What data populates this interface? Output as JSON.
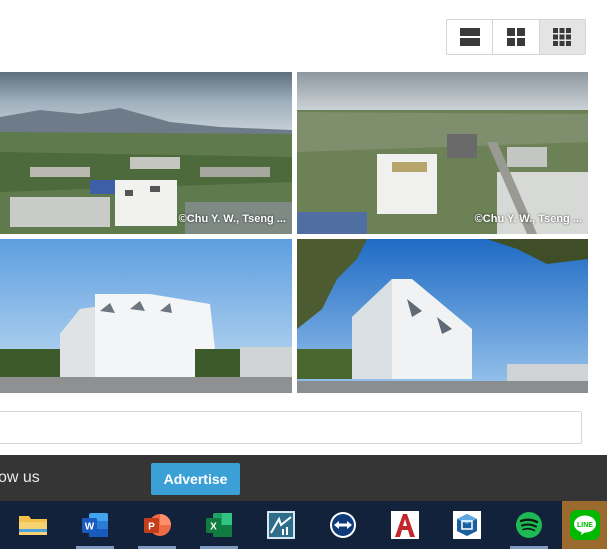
{
  "view_toggles": [
    {
      "name": "single-column-view-icon",
      "active": false
    },
    {
      "name": "two-column-grid-view-icon",
      "active": false
    },
    {
      "name": "three-column-grid-view-icon",
      "active": true
    }
  ],
  "photos": [
    {
      "credit": "©Chu Y. W., Tseng ..."
    },
    {
      "credit": "©Chu Y. W., Tseng ..."
    },
    {
      "credit": ""
    },
    {
      "credit": ""
    }
  ],
  "footer": {
    "follow_text": "ow us",
    "advertise_label": "Advertise"
  },
  "taskbar": {
    "apps": [
      {
        "name": "file-explorer-icon",
        "color": "#f4c04a",
        "running": false
      },
      {
        "name": "word-icon",
        "color": "#2b5797",
        "running": true
      },
      {
        "name": "powerpoint-icon",
        "color": "#d24726",
        "running": true
      },
      {
        "name": "excel-icon",
        "color": "#1e7145",
        "running": true
      },
      {
        "name": "surveying-app-icon",
        "color": "#2e6e8a",
        "running": false
      },
      {
        "name": "teamviewer-icon",
        "color": "#1d6fd6",
        "running": false
      },
      {
        "name": "autocad-icon",
        "color": "#c1272d",
        "running": false
      },
      {
        "name": "sketchup-icon",
        "color": "#1b5f9e",
        "running": false
      },
      {
        "name": "spotify-icon",
        "color": "#1db954",
        "running": true
      },
      {
        "name": "line-icon",
        "color": "#00b900",
        "running": false
      }
    ],
    "line_label": "LINE"
  }
}
